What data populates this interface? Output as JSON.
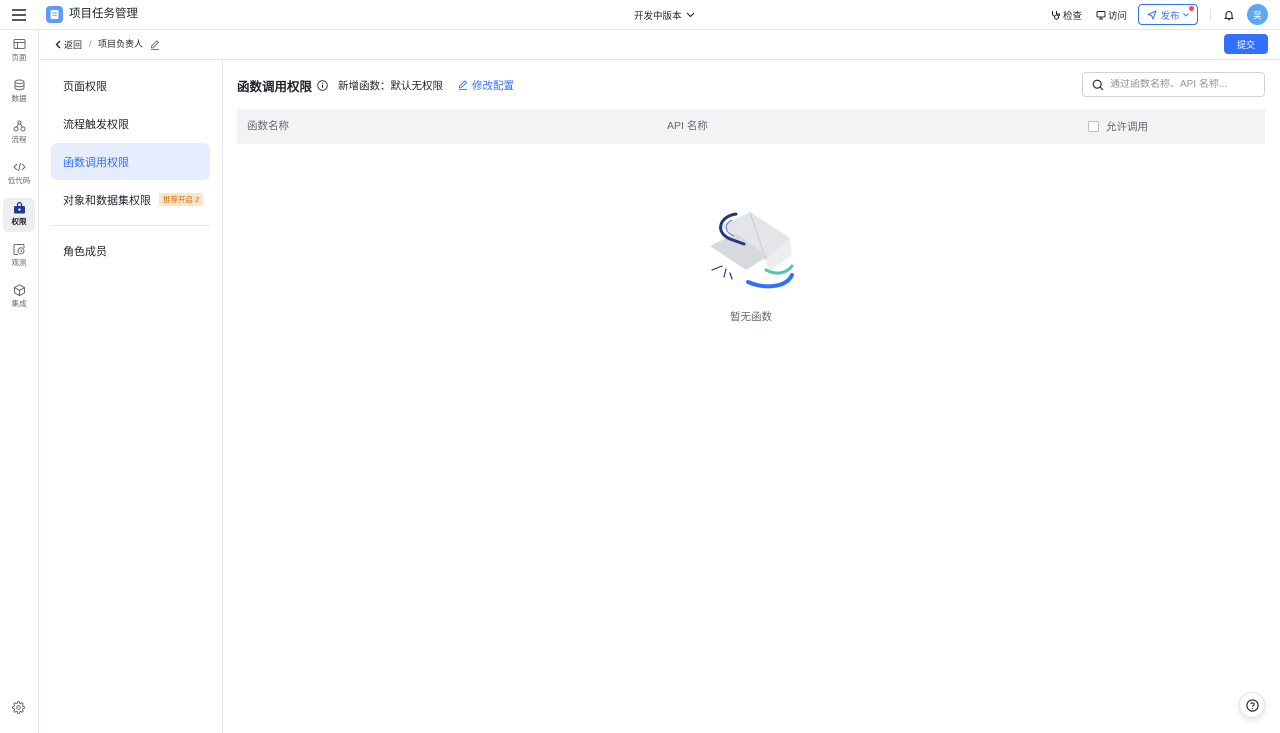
{
  "header": {
    "app_title": "项目任务管理",
    "version": "开发中版本",
    "check_label": "检查",
    "visit_label": "访问",
    "publish_label": "发布",
    "avatar_text": "吴",
    "icons": [
      "menu-icon",
      "app-logo-icon",
      "chevron-down-icon",
      "stethoscope-icon",
      "monitor-icon",
      "send-icon",
      "bell-icon"
    ]
  },
  "rail": {
    "items": [
      {
        "label": "页面",
        "icon": "page-icon",
        "active": false
      },
      {
        "label": "数据",
        "icon": "database-icon",
        "active": false
      },
      {
        "label": "流程",
        "icon": "flow-icon",
        "active": false
      },
      {
        "label": "低代码",
        "icon": "code-icon",
        "active": false
      },
      {
        "label": "权限",
        "icon": "permission-icon",
        "active": true
      },
      {
        "label": "观测",
        "icon": "observe-icon",
        "active": false
      },
      {
        "label": "集成",
        "icon": "integration-icon",
        "active": false
      }
    ],
    "settings_icon": "gear-icon"
  },
  "subheader": {
    "back_label": "返回",
    "separator": "/",
    "role_name": "项目负责人",
    "submit_label": "提交"
  },
  "sidebar": {
    "items": [
      {
        "label": "页面权限",
        "active": false
      },
      {
        "label": "流程触发权限",
        "active": false
      },
      {
        "label": "函数调用权限",
        "active": true
      },
      {
        "label": "对象和数据集权限",
        "badge": "推荐开启 2",
        "active": false
      }
    ],
    "footer_items": [
      {
        "label": "角色成员",
        "active": false
      }
    ]
  },
  "main": {
    "title": "函数调用权限",
    "default_policy": "新增函数：默认无权限",
    "edit_config_label": "修改配置",
    "search_placeholder": "通过函数名称、API 名称...",
    "table": {
      "columns": [
        "函数名称",
        "API 名称",
        "允许调用"
      ],
      "allow_all_checked": false,
      "rows": []
    },
    "empty_text": "暂无函数"
  },
  "colors": {
    "accent": "#3370ff",
    "active_bg": "#e6edff",
    "badge_bg": "#fde5cc",
    "badge_text": "#d46b08",
    "notify_dot": "#f54a45",
    "avatar_bg": "#5aa9f6"
  }
}
